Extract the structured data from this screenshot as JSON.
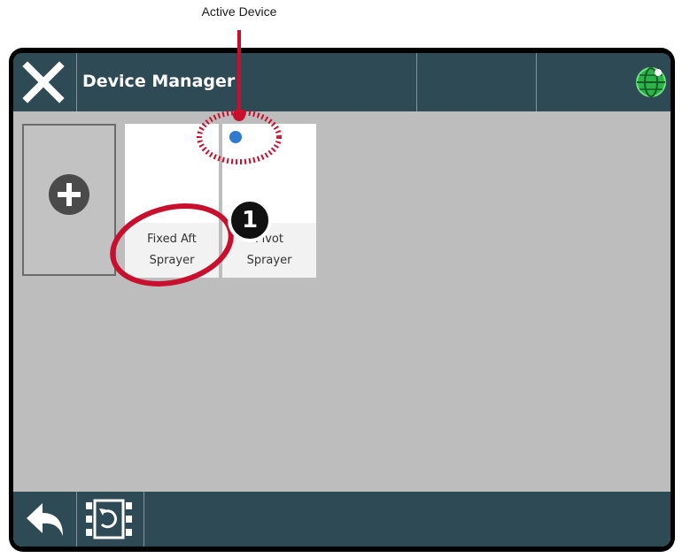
{
  "callout": {
    "label": "Active Device",
    "badge_number": "1"
  },
  "header": {
    "title": "Device Manager",
    "close_icon": "close-icon",
    "globe_icon": "globe-icon"
  },
  "devices": [
    {
      "label_line1": "Fixed Aft",
      "label_line2": "Sprayer",
      "active": false
    },
    {
      "label_line1": "Pivot",
      "label_line2": "Sprayer",
      "active": true
    }
  ],
  "add_tile": {
    "icon": "plus-icon"
  },
  "footer": {
    "back_icon": "back-arrow-icon",
    "switch_icon": "switch-device-icon"
  },
  "colors": {
    "header_bg": "#2e4a55",
    "content_bg": "#bdbdbd",
    "active_dot": "#2f79cf",
    "callout_red": "#c8102e",
    "globe_green": "#2db34a"
  }
}
